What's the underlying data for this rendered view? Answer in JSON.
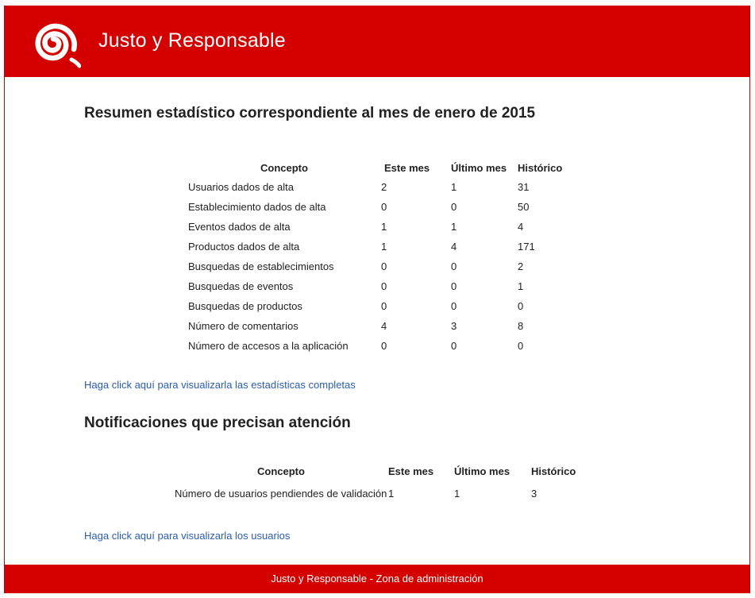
{
  "header": {
    "site_title": "Justo y Responsable",
    "logo_icon": "spiral-logo-icon",
    "background_color": "#d40000"
  },
  "summary": {
    "title": "Resumen estadístico correspondiente al mes de enero de 2015",
    "columns": [
      "Concepto",
      "Este mes",
      "Último mes",
      "Histórico"
    ],
    "rows": [
      [
        "Usuarios dados de alta",
        "2",
        "1",
        "31"
      ],
      [
        "Establecimiento dados de alta",
        "0",
        "0",
        "50"
      ],
      [
        "Eventos dados de alta",
        "1",
        "1",
        "4"
      ],
      [
        "Productos dados de alta",
        "1",
        "4",
        "171"
      ],
      [
        "Busquedas de establecimientos",
        "0",
        "0",
        "2"
      ],
      [
        "Busquedas de eventos",
        "0",
        "0",
        "1"
      ],
      [
        "Busquedas de productos",
        "0",
        "0",
        "0"
      ],
      [
        "Número de comentarios",
        "4",
        "3",
        "8"
      ],
      [
        "Número de accesos a la aplicación",
        "0",
        "0",
        "0"
      ]
    ],
    "link_text": "Haga click aquí para visualizarla las estadísticas completas"
  },
  "notifications": {
    "title": "Notificaciones que precisan atención",
    "columns": [
      "Concepto",
      "Este mes",
      "Último mes",
      "Histórico"
    ],
    "rows": [
      [
        "Número de usuarios pendiendes de validación",
        "1",
        "1",
        "3"
      ]
    ],
    "link_text": "Haga click aquí para visualizarla los usuarios"
  },
  "footer": {
    "text": "Justo y Responsable - Zona de administración"
  },
  "colors": {
    "brand_red": "#d40000",
    "link_blue": "#2a5db0"
  }
}
